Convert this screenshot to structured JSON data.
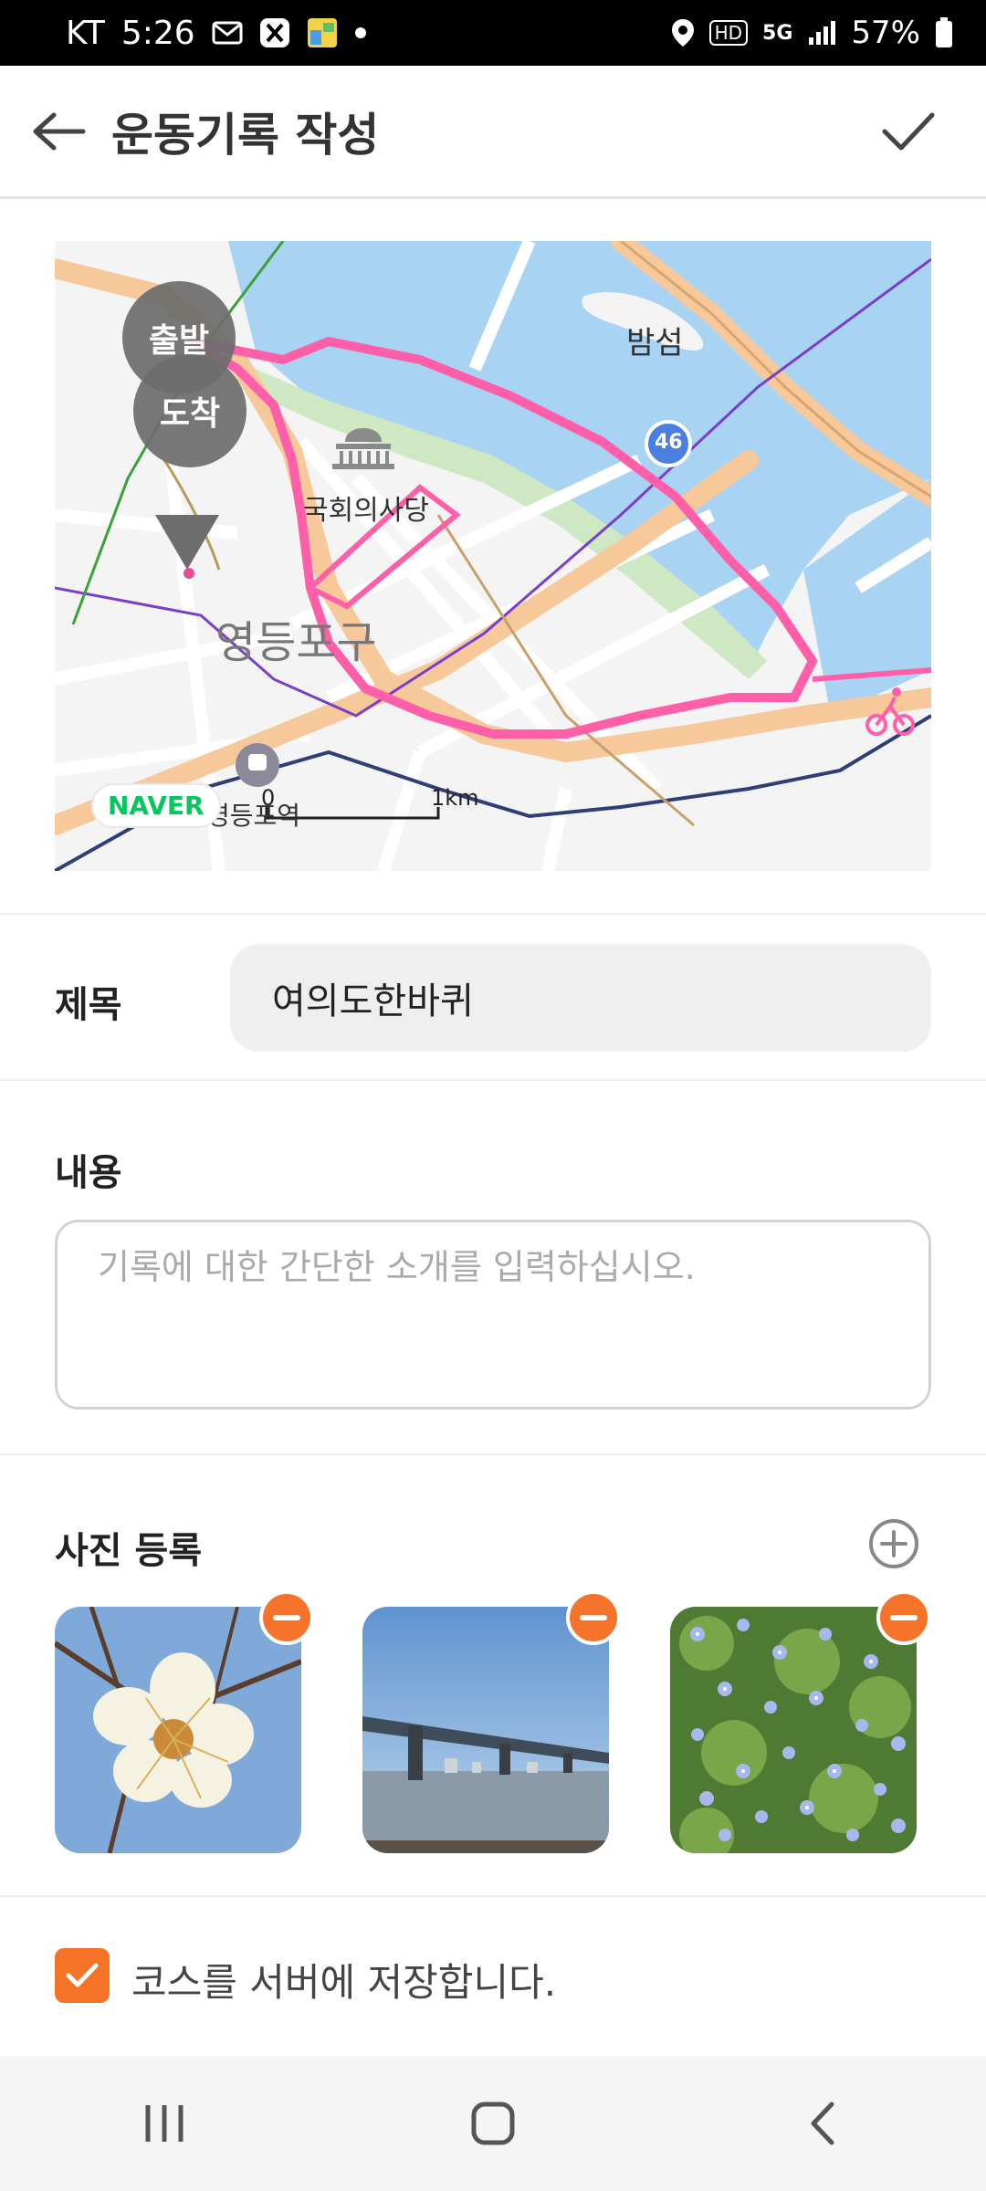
{
  "status_bar": {
    "carrier": "KT",
    "time": "5:26",
    "network": "5G",
    "hd": "HD",
    "battery": "57%",
    "icons": [
      "mail-icon",
      "app-x-icon",
      "calendar-app-icon",
      "dot-icon",
      "location-icon",
      "signal-icon",
      "battery-icon"
    ]
  },
  "app_bar": {
    "title": "운동기록 작성",
    "back_icon": "arrow-left-icon",
    "confirm_icon": "check-icon"
  },
  "map": {
    "labels": {
      "island": "밤섬",
      "assembly": "국회의사당",
      "district": "영등포구",
      "station": "영등포역",
      "route_number": "46"
    },
    "pins": {
      "start": "출발",
      "end": "도착"
    },
    "logo": "NAVER",
    "scale": {
      "zero": "0",
      "km": "1km"
    },
    "colors": {
      "route": "#ff5fa8",
      "water": "#a8d3f3",
      "road": "#f6c89a",
      "park": "#cfe8c4"
    }
  },
  "form": {
    "title_label": "제목",
    "title_value": "여의도한바퀴",
    "content_label": "내용",
    "content_placeholder": "기록에 대한 간단한 소개를 입력하십시오.",
    "photos_label": "사진 등록",
    "photos": [
      {
        "name": "photo-flower-blossom"
      },
      {
        "name": "photo-bridge-river"
      },
      {
        "name": "photo-blue-flowers"
      }
    ],
    "save_course_checked": true,
    "save_course_label": "코스를 서버에 저장합니다."
  },
  "nav_bar": {
    "items": [
      "recent-apps-icon",
      "home-icon",
      "back-icon"
    ]
  },
  "accent_color": "#f47327"
}
